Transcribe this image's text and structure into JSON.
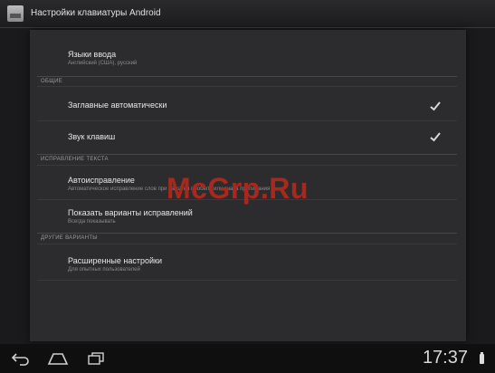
{
  "window": {
    "title": "Настройки клавиатуры Android"
  },
  "settings": {
    "input_languages": {
      "label": "Языки ввода",
      "summary": "Английский (США), русский"
    },
    "section_general": "Общие",
    "auto_caps": {
      "label": "Заглавные автоматически",
      "checked": true
    },
    "key_sound": {
      "label": "Звук клавиш",
      "checked": true
    },
    "section_correction": "Исправление текста",
    "autocorrect": {
      "label": "Автоисправление",
      "summary": "Автоматическое исправление слов при нажатии пробела или знака препинания"
    },
    "show_suggestions": {
      "label": "Показать варианты исправлений",
      "summary": "Всегда показывать"
    },
    "section_other": "Другие варианты",
    "advanced": {
      "label": "Расширенные настройки",
      "summary": "Для опытных пользователей"
    }
  },
  "watermark": {
    "text": "McGrp.Ru",
    "color": "#a7281c"
  },
  "navbar": {
    "back_icon": "back-icon",
    "home_icon": "home-icon",
    "recents_icon": "recent-apps-icon",
    "time": "17:37",
    "battery_icon": "battery-icon"
  },
  "colors": {
    "background": "#1a1a1c",
    "panel": "#2c2c2e",
    "text": "#e6e6e6"
  }
}
